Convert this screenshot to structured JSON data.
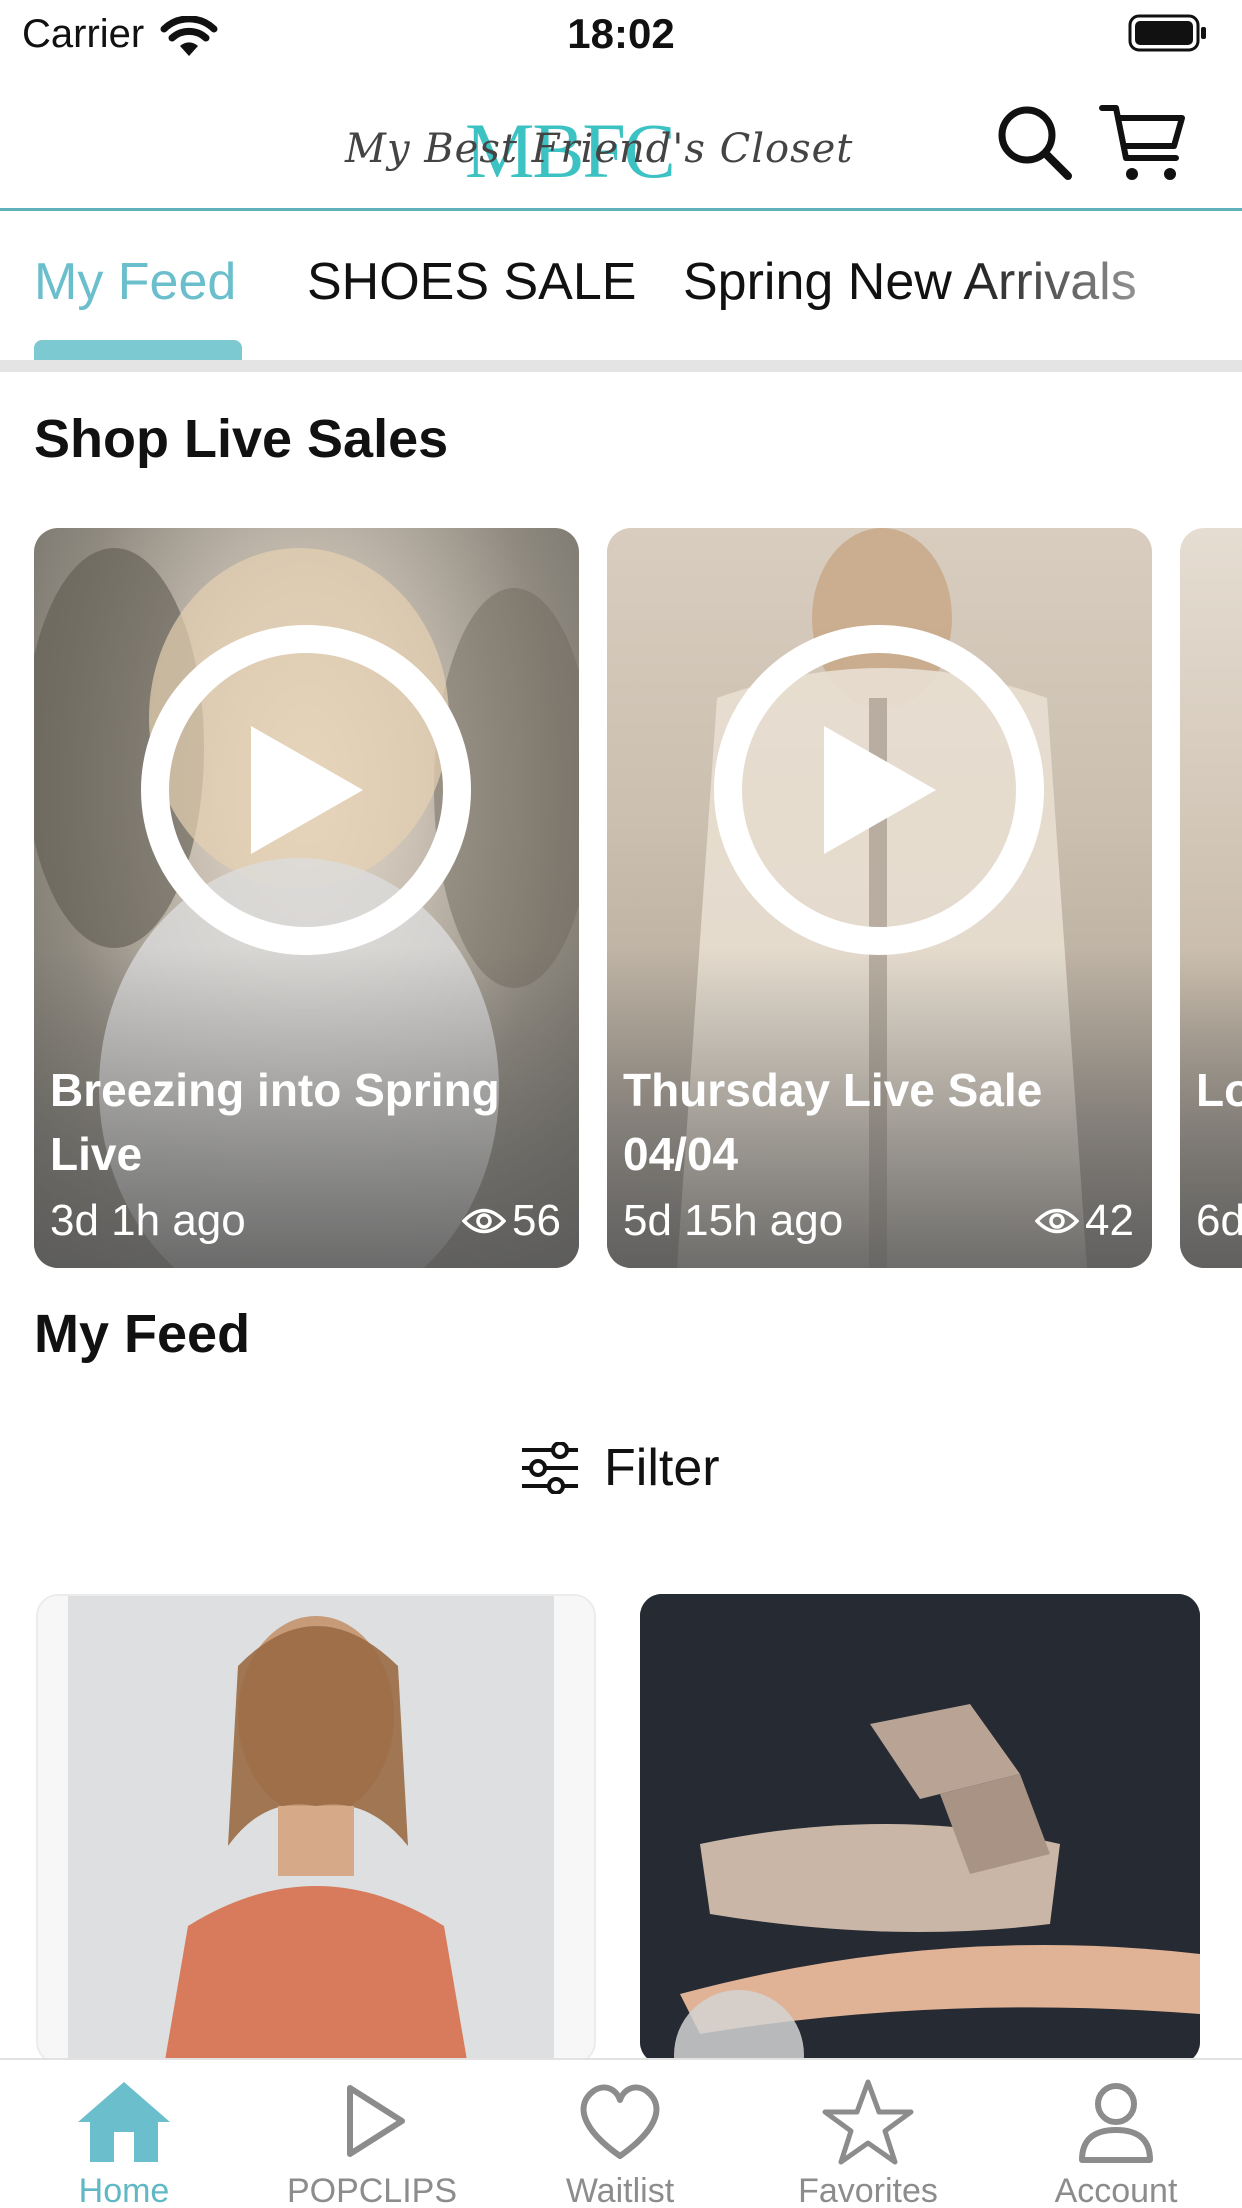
{
  "status_bar": {
    "carrier": "Carrier",
    "time": "18:02"
  },
  "header": {
    "logo_mark": "MBFC",
    "logo_script": "My Best Friend's Closet"
  },
  "tabs": [
    {
      "label": "My Feed",
      "active": true
    },
    {
      "label": "SHOES SALE",
      "active": false
    },
    {
      "label": "Spring New Arrivals",
      "active": false
    }
  ],
  "live_section": {
    "title": "Shop Live Sales",
    "cards": [
      {
        "title": "Breezing into Spring Live",
        "age": "3d 1h ago",
        "views": "56"
      },
      {
        "title": "Thursday Live Sale 04/04",
        "age": "5d 15h ago",
        "views": "42"
      },
      {
        "title": "Lo Liv",
        "age": "6d"
      }
    ]
  },
  "feed_section": {
    "title": "My Feed",
    "filter_label": "Filter"
  },
  "bottom_nav": [
    {
      "label": "Home",
      "icon": "home-icon",
      "active": true
    },
    {
      "label": "POPCLIPS",
      "icon": "play-icon",
      "active": false
    },
    {
      "label": "Waitlist",
      "icon": "heart-icon",
      "active": false
    },
    {
      "label": "Favorites",
      "icon": "star-icon",
      "active": false
    },
    {
      "label": "Account",
      "icon": "person-icon",
      "active": false
    }
  ],
  "colors": {
    "accent": "#6bbfcc",
    "nav_active": "#5fb8c4",
    "nav_inactive": "#8c8c8c"
  }
}
